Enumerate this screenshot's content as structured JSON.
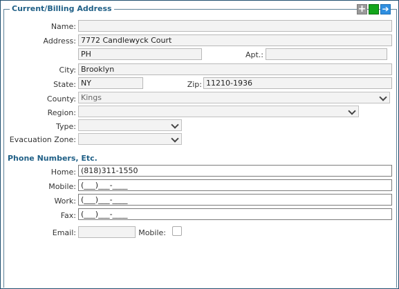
{
  "panel": {
    "legend": "Current/Billing Address",
    "tools": {
      "add_symbol": "+",
      "go_symbol": "➔"
    }
  },
  "address": {
    "name_label": "Name:",
    "name_value": "",
    "address_label": "Address:",
    "address_value": "7772 Candlewyck Court",
    "address2_value": "PH",
    "apt_label": "Apt.:",
    "apt_value": "",
    "city_label": "City:",
    "city_value": "Brooklyn",
    "state_label": "State:",
    "state_value": "NY",
    "zip_label": "Zip:",
    "zip_value": "11210-1936",
    "county_label": "County:",
    "county_value": "Kings",
    "region_label": "Region:",
    "region_value": "",
    "type_label": "Type:",
    "type_value": "",
    "evac_label": "Evacuation Zone:",
    "evac_value": ""
  },
  "phones": {
    "heading": "Phone Numbers, Etc.",
    "home_label": "Home:",
    "home_value": "(818)311-1550",
    "mobile_label": "Mobile:",
    "mobile_value": "(___)___-____",
    "work_label": "Work:",
    "work_value": "(___)___-____",
    "fax_label": "Fax:",
    "fax_value": "(___)___-____",
    "email_label": "Email:",
    "email_value": "",
    "email_mobile_label": "Mobile:",
    "email_mobile_checked": false
  },
  "colors": {
    "heading": "#1f5f86",
    "border": "#1f4f6f",
    "green_tool": "#14a61c",
    "blue_tool": "#2f8fe0"
  },
  "icons": [
    "plus-icon",
    "green-square-icon",
    "arrow-right-icon",
    "chevron-down-icon"
  ]
}
